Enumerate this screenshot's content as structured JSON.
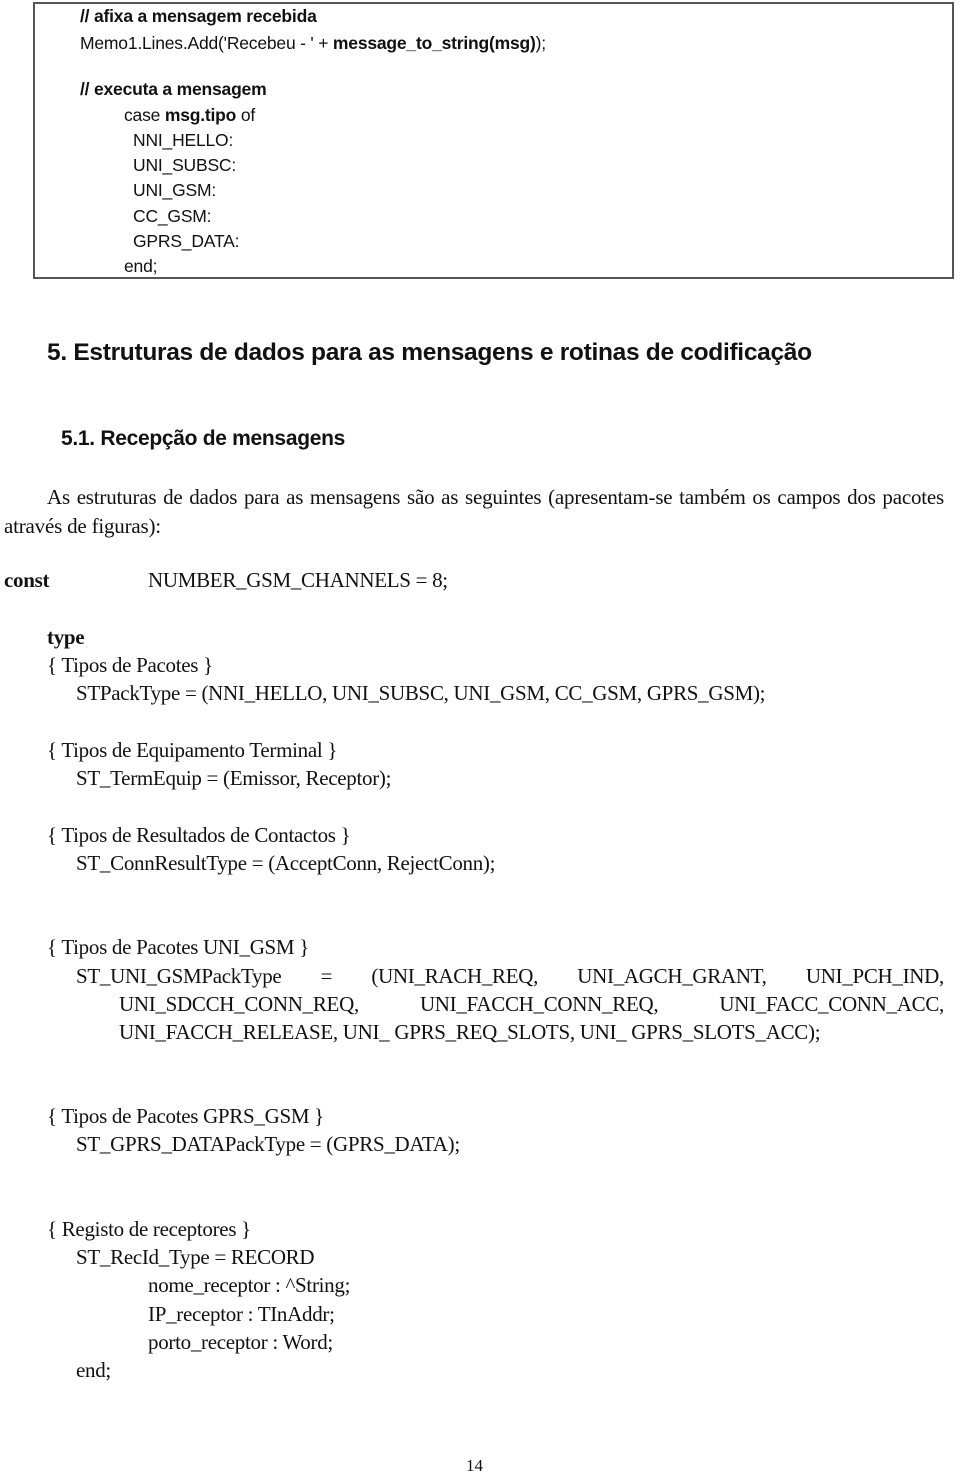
{
  "code_box": {
    "comment_display": "// afixa a mensagem recebida",
    "memo_prefix": "Memo1.Lines.Add('Recebeu - ' + ",
    "memo_call": "message_to_string(msg)",
    "memo_suffix": ");",
    "comment_execute": "// executa a mensagem",
    "case_keyword": "case ",
    "case_expr": "msg.tipo",
    "case_of": " of",
    "case_labels": [
      "NNI_HELLO:",
      "UNI_SUBSC:",
      "UNI_GSM:",
      "CC_GSM:",
      "GPRS_DATA:"
    ],
    "end": "end;"
  },
  "section": {
    "heading": "5. Estruturas de dados para as mensagens e rotinas de codificação",
    "subheading": "5.1. Recepção de mensagens",
    "intro": "As estruturas de dados para as mensagens são as seguintes (apresentam-se também os campos dos pacotes através de figuras):"
  },
  "const_block": {
    "keyword": "const",
    "declaration": "NUMBER_GSM_CHANNELS = 8;"
  },
  "type_block": {
    "keyword": "type",
    "groups": [
      {
        "comment": "{ Tipos de Pacotes }",
        "lines": [
          "STPackType = (NNI_HELLO, UNI_SUBSC, UNI_GSM, CC_GSM, GPRS_GSM);"
        ]
      },
      {
        "comment": "{ Tipos de Equipamento Terminal }",
        "lines": [
          "ST_TermEquip = (Emissor, Receptor);"
        ]
      },
      {
        "comment": "{ Tipos de Resultados de Contactos }",
        "lines": [
          "ST_ConnResultType = (AcceptConn, RejectConn);"
        ]
      },
      {
        "comment": "{ Tipos de Pacotes UNI_GSM }",
        "line1_parts": [
          "ST_UNI_GSMPackType",
          "=",
          "(UNI_RACH_REQ,",
          "UNI_AGCH_GRANT,",
          "UNI_PCH_IND,"
        ],
        "line2_parts": [
          "UNI_SDCCH_CONN_REQ,",
          "UNI_FACCH_CONN_REQ,",
          "UNI_FACC_CONN_ACC,"
        ],
        "line3": "UNI_FACCH_RELEASE, UNI_ GPRS_REQ_SLOTS, UNI_ GPRS_SLOTS_ACC);"
      },
      {
        "comment": "{ Tipos de Pacotes GPRS_GSM }",
        "lines": [
          "ST_GPRS_DATAPackType = (GPRS_DATA);"
        ]
      },
      {
        "comment": "{ Registo de receptores }",
        "header": "ST_RecId_Type = RECORD",
        "fields": [
          "nome_receptor : ^String;",
          "IP_receptor : TInAddr;",
          "porto_receptor : Word;"
        ],
        "end": "end;"
      }
    ]
  },
  "footer": {
    "page_number": "14"
  }
}
